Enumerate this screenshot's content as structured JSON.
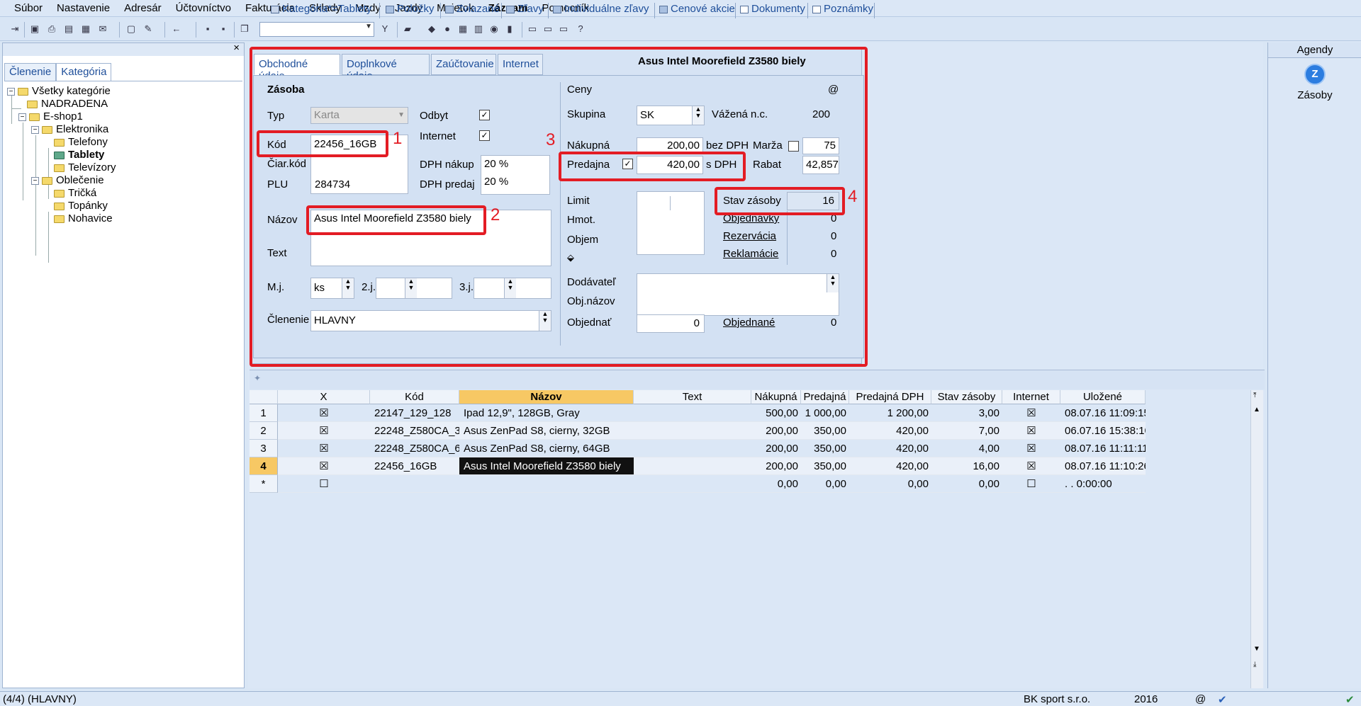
{
  "menu": [
    "Súbor",
    "Nastavenie",
    "Adresár",
    "Účtovníctvo",
    "Fakturácia",
    "Sklady",
    "Mzdy",
    "Jazdy",
    "Majetok",
    "Záznam",
    "Pomocník"
  ],
  "left_panel": {
    "close": "×",
    "tabs": [
      "Členenie",
      "Kategória"
    ],
    "tree": [
      {
        "label": "Všetky kategórie"
      },
      {
        "label": "NADRADENA"
      },
      {
        "label": "E-shop1"
      },
      {
        "label": "Elektronika"
      },
      {
        "label": "Telefony"
      },
      {
        "label": "Tablety"
      },
      {
        "label": "Televízory"
      },
      {
        "label": "Oblečenie"
      },
      {
        "label": "Tričká"
      },
      {
        "label": "Topánky"
      },
      {
        "label": "Nohavice"
      }
    ]
  },
  "form": {
    "tabs": [
      "Obchodné údaje",
      "Doplnkové údaje",
      "Zaúčtovanie",
      "Internet"
    ],
    "title": "Asus Intel Moorefield Z3580 biely",
    "zasoba": {
      "section": "Zásoba",
      "typ_label": "Typ",
      "typ_value": "Karta",
      "kod_label": "Kód",
      "kod_value": "22456_16GB",
      "ciarkod_label": "Čiar.kód",
      "ciarkod_value": "",
      "plu_label": "PLU",
      "plu_value": "284734",
      "nazov_label": "Názov",
      "nazov_value": "Asus Intel Moorefield Z3580 biely",
      "text_label": "Text",
      "text_value": "",
      "mj_label": "M.j.",
      "mj_value": "ks",
      "j2_label": "2.j.",
      "j3_label": "3.j.",
      "clenenie_label": "Členenie",
      "clenenie_value": "HLAVNY",
      "odbyt_label": "Odbyt",
      "internet_label": "Internet",
      "dph_nakup_label": "DPH nákup",
      "dph_nakup_value": "20 %",
      "dph_predaj_label": "DPH predaj",
      "dph_predaj_value": "20 %"
    },
    "ceny": {
      "section": "Ceny",
      "at": "@",
      "skupina_label": "Skupina",
      "skupina_value": "SK",
      "vazena_label": "Vážená n.c.",
      "vazena_value": "200",
      "nakupna_label": "Nákupná",
      "nakupna_value": "200,00",
      "bez_dph": "bez DPH",
      "marza_label": "Marža",
      "marza_value": "75",
      "predajna_label": "Predajna",
      "predajna_value": "420,00",
      "s_dph": "s DPH",
      "rabat_label": "Rabat",
      "rabat_value": "42,857",
      "limit_label": "Limit",
      "hmot_label": "Hmot.",
      "objem_label": "Objem",
      "stav_label": "Stav zásoby",
      "stav_value": "16",
      "objednavky_label": "Objednávky",
      "objednavky_value": "0",
      "rezervacia_label": "Rezervácia",
      "rezervacia_value": "0",
      "reklamacie_label": "Reklamácie",
      "reklamacie_value": "0",
      "dodavatel_label": "Dodávateľ",
      "objnazov_label": "Obj.názov",
      "objednat_label": "Objednať",
      "objednat_value": "0",
      "objednane_label": "Objednané",
      "objednane_value": "0"
    },
    "annotations": [
      "1",
      "2",
      "3",
      "4"
    ]
  },
  "bottom_tabs": [
    "Kategória*=Tablety",
    "Položky",
    "Zviazané",
    "Zľavy",
    "Individuálne zľavy",
    "Cenové akcie",
    "Dokumenty",
    "Poznámky"
  ],
  "grid": {
    "columns": [
      "X",
      "Kód",
      "Názov",
      "Text",
      "Nákupná",
      "Predajná",
      "Predajná DPH",
      "Stav zásoby",
      "Internet",
      "Uložené"
    ],
    "rows": [
      {
        "n": "1",
        "x": "☒",
        "kod": "22147_129_128",
        "nazov": "Ipad 12,9\", 128GB, Gray",
        "text": "",
        "nakupna": "500,00",
        "predajna": "1 000,00",
        "predajna_dph": "1 200,00",
        "stav": "3,00",
        "internet": "☒",
        "ulozene": "08.07.16 11:09:15"
      },
      {
        "n": "2",
        "x": "☒",
        "kod": "22248_Z580CA_3",
        "nazov": "Asus ZenPad S8, cierny, 32GB",
        "text": "",
        "nakupna": "200,00",
        "predajna": "350,00",
        "predajna_dph": "420,00",
        "stav": "7,00",
        "internet": "☒",
        "ulozene": "06.07.16 15:38:10"
      },
      {
        "n": "3",
        "x": "☒",
        "kod": "22248_Z580CA_6",
        "nazov": "Asus ZenPad S8, cierny, 64GB",
        "text": "",
        "nakupna": "200,00",
        "predajna": "350,00",
        "predajna_dph": "420,00",
        "stav": "4,00",
        "internet": "☒",
        "ulozene": "08.07.16 11:11:11"
      },
      {
        "n": "4",
        "x": "☒",
        "kod": "22456_16GB",
        "nazov": "Asus Intel Moorefield Z3580 biely",
        "text": "",
        "nakupna": "200,00",
        "predajna": "350,00",
        "predajna_dph": "420,00",
        "stav": "16,00",
        "internet": "☒",
        "ulozene": "08.07.16 11:10:26"
      },
      {
        "n": "*",
        "x": "☐",
        "kod": "",
        "nazov": "",
        "text": "",
        "nakupna": "0,00",
        "predajna": "0,00",
        "predajna_dph": "0,00",
        "stav": "0,00",
        "internet": "☐",
        "ulozene": ". .   0:00:00"
      }
    ]
  },
  "agenda": {
    "title": "Agendy",
    "item": "Zásoby"
  },
  "status": {
    "left": "(4/4) (HLAVNY)",
    "company": "BK sport  s.r.o.",
    "year": "2016",
    "at": "@"
  }
}
